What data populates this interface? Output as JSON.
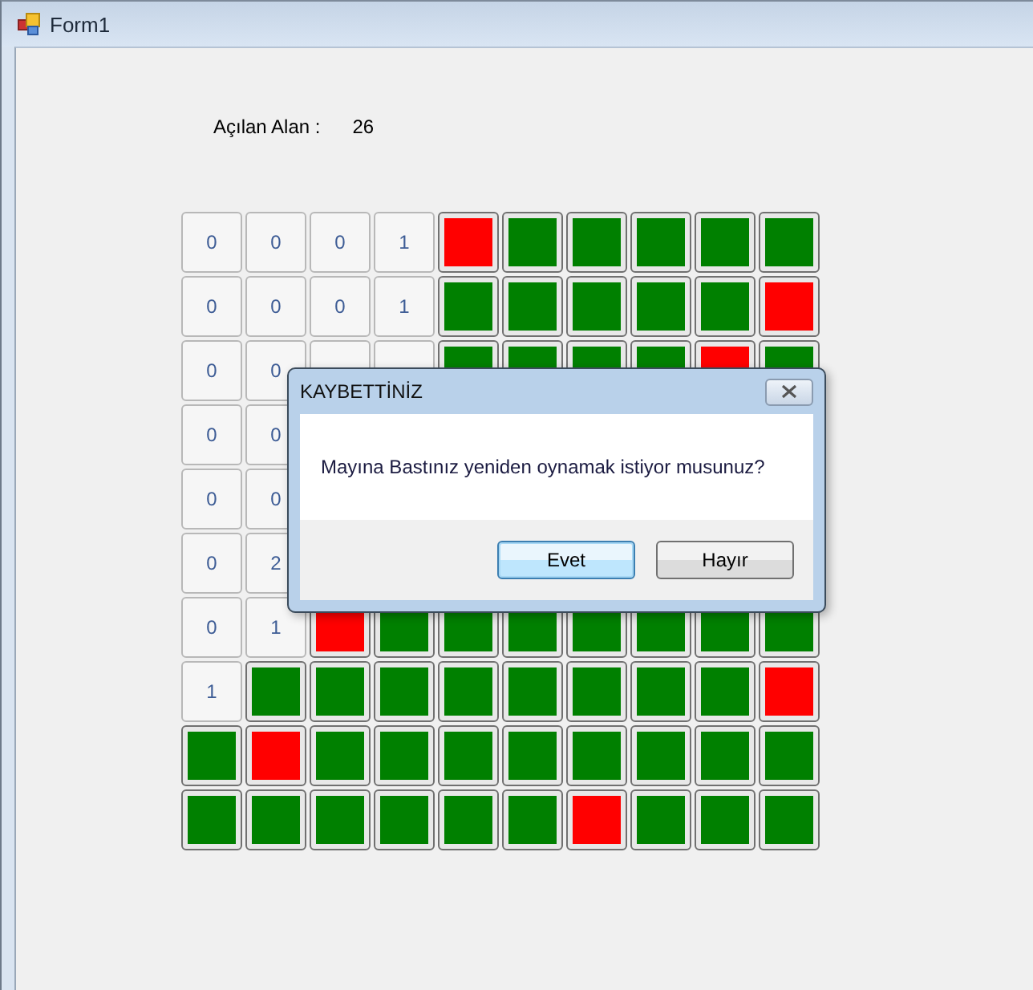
{
  "window": {
    "title": "Form1"
  },
  "opened": {
    "label": "Açılan Alan :",
    "value": "26"
  },
  "grid": [
    [
      {
        "kind": "open",
        "text": "0"
      },
      {
        "kind": "open",
        "text": "0"
      },
      {
        "kind": "open",
        "text": "0"
      },
      {
        "kind": "open",
        "text": "1"
      },
      {
        "kind": "mine"
      },
      {
        "kind": "closed"
      },
      {
        "kind": "closed"
      },
      {
        "kind": "closed"
      },
      {
        "kind": "closed"
      },
      {
        "kind": "closed"
      }
    ],
    [
      {
        "kind": "open",
        "text": "0"
      },
      {
        "kind": "open",
        "text": "0"
      },
      {
        "kind": "open",
        "text": "0"
      },
      {
        "kind": "open",
        "text": "1"
      },
      {
        "kind": "closed"
      },
      {
        "kind": "closed"
      },
      {
        "kind": "closed"
      },
      {
        "kind": "closed"
      },
      {
        "kind": "closed"
      },
      {
        "kind": "mine"
      }
    ],
    [
      {
        "kind": "open",
        "text": "0"
      },
      {
        "kind": "open",
        "text": "0"
      },
      {
        "kind": "open_covered"
      },
      {
        "kind": "open_covered"
      },
      {
        "kind": "closed"
      },
      {
        "kind": "closed"
      },
      {
        "kind": "closed"
      },
      {
        "kind": "closed"
      },
      {
        "kind": "mine"
      },
      {
        "kind": "closed"
      }
    ],
    [
      {
        "kind": "open",
        "text": "0"
      },
      {
        "kind": "open",
        "text": "0"
      },
      {
        "kind": "hidden"
      },
      {
        "kind": "hidden"
      },
      {
        "kind": "hidden"
      },
      {
        "kind": "hidden"
      },
      {
        "kind": "hidden"
      },
      {
        "kind": "hidden"
      },
      {
        "kind": "hidden"
      },
      {
        "kind": "hidden"
      }
    ],
    [
      {
        "kind": "open",
        "text": "0"
      },
      {
        "kind": "open",
        "text": "0"
      },
      {
        "kind": "hidden"
      },
      {
        "kind": "hidden"
      },
      {
        "kind": "hidden"
      },
      {
        "kind": "hidden"
      },
      {
        "kind": "hidden"
      },
      {
        "kind": "hidden"
      },
      {
        "kind": "hidden"
      },
      {
        "kind": "hidden"
      }
    ],
    [
      {
        "kind": "open",
        "text": "0"
      },
      {
        "kind": "open",
        "text": "2"
      },
      {
        "kind": "hidden"
      },
      {
        "kind": "hidden"
      },
      {
        "kind": "hidden"
      },
      {
        "kind": "hidden"
      },
      {
        "kind": "hidden"
      },
      {
        "kind": "hidden"
      },
      {
        "kind": "hidden"
      },
      {
        "kind": "hidden"
      }
    ],
    [
      {
        "kind": "open",
        "text": "0"
      },
      {
        "kind": "open",
        "text": "1"
      },
      {
        "kind": "mine"
      },
      {
        "kind": "closed"
      },
      {
        "kind": "closed"
      },
      {
        "kind": "closed"
      },
      {
        "kind": "closed"
      },
      {
        "kind": "closed"
      },
      {
        "kind": "closed"
      },
      {
        "kind": "closed"
      }
    ],
    [
      {
        "kind": "open",
        "text": "1"
      },
      {
        "kind": "closed"
      },
      {
        "kind": "closed"
      },
      {
        "kind": "closed"
      },
      {
        "kind": "closed"
      },
      {
        "kind": "closed"
      },
      {
        "kind": "closed"
      },
      {
        "kind": "closed"
      },
      {
        "kind": "closed"
      },
      {
        "kind": "mine"
      }
    ],
    [
      {
        "kind": "closed"
      },
      {
        "kind": "mine"
      },
      {
        "kind": "closed"
      },
      {
        "kind": "closed"
      },
      {
        "kind": "closed"
      },
      {
        "kind": "closed"
      },
      {
        "kind": "closed"
      },
      {
        "kind": "closed"
      },
      {
        "kind": "closed"
      },
      {
        "kind": "closed"
      }
    ],
    [
      {
        "kind": "closed"
      },
      {
        "kind": "closed"
      },
      {
        "kind": "closed"
      },
      {
        "kind": "closed"
      },
      {
        "kind": "closed"
      },
      {
        "kind": "closed"
      },
      {
        "kind": "mine"
      },
      {
        "kind": "closed"
      },
      {
        "kind": "closed"
      },
      {
        "kind": "closed"
      }
    ]
  ],
  "dialog": {
    "title": "KAYBETTİNİZ",
    "message": "Mayına Bastınız yeniden oynamak istiyor musunuz?",
    "buttons": [
      {
        "label": "Evet",
        "default": true
      },
      {
        "label": "Hayır",
        "default": false
      }
    ]
  }
}
